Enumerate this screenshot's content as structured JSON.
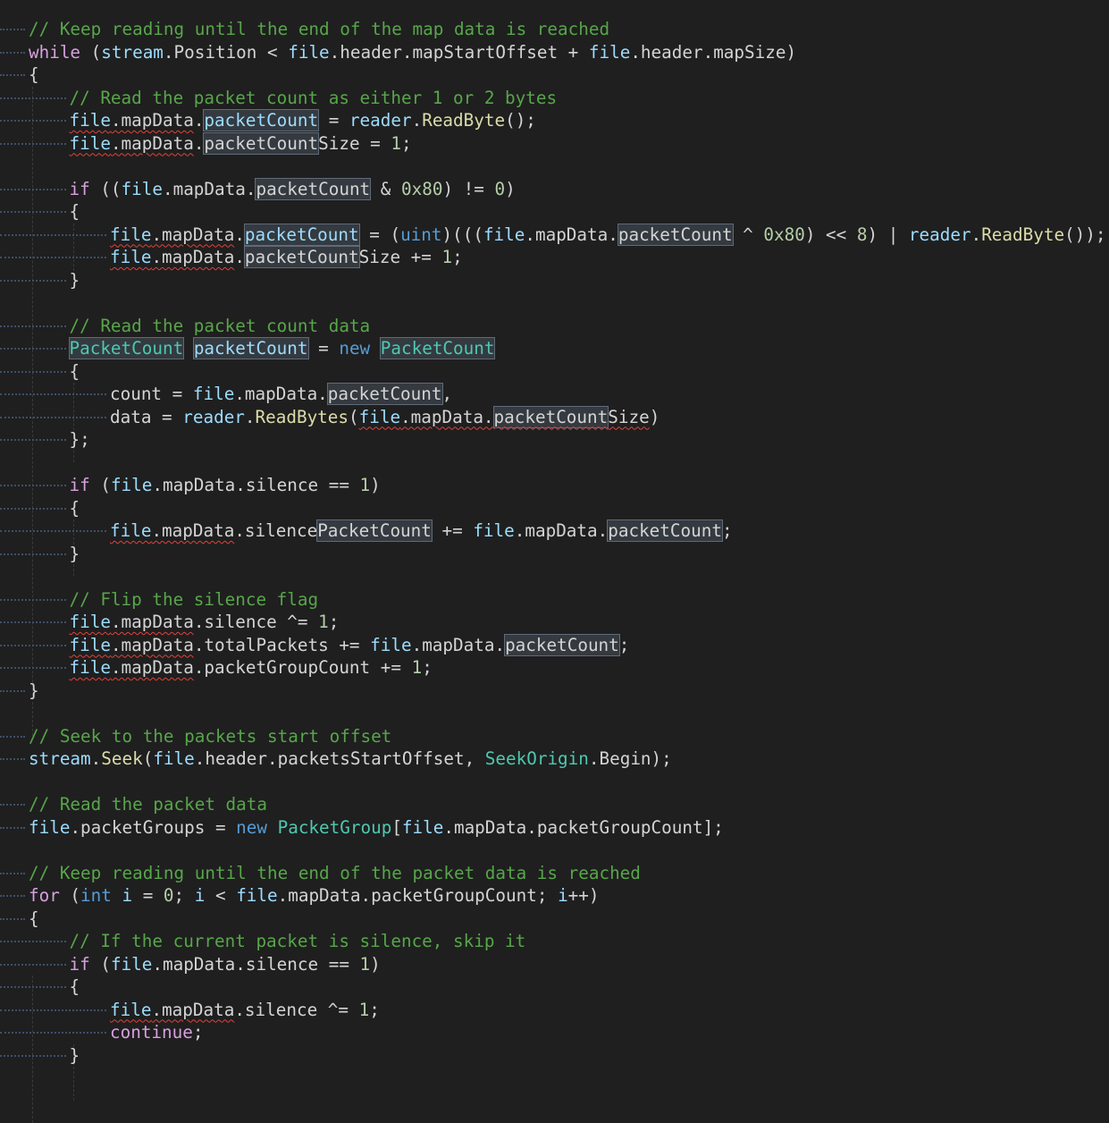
{
  "editor": {
    "lines": [
      {
        "i": 0,
        "t": [
          {
            "s": "// Keep reading until the end of the map data is reached",
            "c": "comment"
          }
        ]
      },
      {
        "i": 0,
        "t": [
          {
            "s": "while",
            "c": "kw-flow"
          },
          {
            "s": " (",
            "c": "punc"
          },
          {
            "s": "stream",
            "c": "var"
          },
          {
            "s": ".Position < ",
            "c": "punc"
          },
          {
            "s": "file",
            "c": "var"
          },
          {
            "s": ".header.mapStartOffset + ",
            "c": "punc"
          },
          {
            "s": "file",
            "c": "var"
          },
          {
            "s": ".header.mapSize)",
            "c": "punc"
          }
        ]
      },
      {
        "i": 0,
        "t": [
          {
            "s": "{",
            "c": "punc"
          }
        ]
      },
      {
        "i": 1,
        "t": [
          {
            "s": "// Read the packet count as either 1 or 2 bytes",
            "c": "comment"
          }
        ]
      },
      {
        "i": 1,
        "t": [
          {
            "s": "file",
            "c": "var sq"
          },
          {
            "s": ".mapData",
            "c": "punc sq"
          },
          {
            "s": ".",
            "c": "punc"
          },
          {
            "s": "packetCount",
            "c": "var hl"
          },
          {
            "s": " = ",
            "c": "punc"
          },
          {
            "s": "reader",
            "c": "var"
          },
          {
            "s": ".",
            "c": "punc"
          },
          {
            "s": "ReadByte",
            "c": "method"
          },
          {
            "s": "();",
            "c": "punc"
          }
        ]
      },
      {
        "i": 1,
        "t": [
          {
            "s": "file",
            "c": "var sq"
          },
          {
            "s": ".mapData",
            "c": "punc sq"
          },
          {
            "s": ".",
            "c": "punc"
          },
          {
            "s": "packetCount",
            "c": "punc hl"
          },
          {
            "s": "Size = ",
            "c": "punc"
          },
          {
            "s": "1",
            "c": "num"
          },
          {
            "s": ";",
            "c": "punc"
          }
        ]
      },
      {
        "i": 0,
        "t": []
      },
      {
        "i": 1,
        "t": [
          {
            "s": "if",
            "c": "kw-flow"
          },
          {
            "s": " ((",
            "c": "punc"
          },
          {
            "s": "file",
            "c": "var"
          },
          {
            "s": ".mapData.",
            "c": "punc"
          },
          {
            "s": "packetCount",
            "c": "punc hl"
          },
          {
            "s": " & ",
            "c": "punc"
          },
          {
            "s": "0x80",
            "c": "num"
          },
          {
            "s": ") != ",
            "c": "punc"
          },
          {
            "s": "0",
            "c": "num"
          },
          {
            "s": ")",
            "c": "punc"
          }
        ]
      },
      {
        "i": 1,
        "t": [
          {
            "s": "{",
            "c": "punc"
          }
        ]
      },
      {
        "i": 2,
        "t": [
          {
            "s": "file",
            "c": "var sq"
          },
          {
            "s": ".mapData",
            "c": "punc sq"
          },
          {
            "s": ".",
            "c": "punc"
          },
          {
            "s": "packetCount",
            "c": "var hl"
          },
          {
            "s": " = (",
            "c": "punc"
          },
          {
            "s": "uint",
            "c": "kw"
          },
          {
            "s": ")(((",
            "c": "punc"
          },
          {
            "s": "file",
            "c": "var"
          },
          {
            "s": ".mapData.",
            "c": "punc"
          },
          {
            "s": "packetCount",
            "c": "punc hl"
          },
          {
            "s": " ^ ",
            "c": "punc"
          },
          {
            "s": "0x80",
            "c": "num"
          },
          {
            "s": ") << ",
            "c": "punc"
          },
          {
            "s": "8",
            "c": "num"
          },
          {
            "s": ") | ",
            "c": "punc"
          },
          {
            "s": "reader",
            "c": "var"
          },
          {
            "s": ".",
            "c": "punc"
          },
          {
            "s": "ReadByte",
            "c": "method"
          },
          {
            "s": "());",
            "c": "punc"
          }
        ]
      },
      {
        "i": 2,
        "t": [
          {
            "s": "file",
            "c": "var sq"
          },
          {
            "s": ".mapData",
            "c": "punc sq"
          },
          {
            "s": ".",
            "c": "punc"
          },
          {
            "s": "packetCount",
            "c": "punc hl"
          },
          {
            "s": "Size += ",
            "c": "punc"
          },
          {
            "s": "1",
            "c": "num"
          },
          {
            "s": ";",
            "c": "punc"
          }
        ]
      },
      {
        "i": 1,
        "t": [
          {
            "s": "}",
            "c": "punc"
          }
        ]
      },
      {
        "i": 0,
        "t": []
      },
      {
        "i": 1,
        "t": [
          {
            "s": "// Read the packet count data",
            "c": "comment"
          }
        ]
      },
      {
        "i": 1,
        "t": [
          {
            "s": "PacketCount",
            "c": "type hl"
          },
          {
            "s": " ",
            "c": "punc"
          },
          {
            "s": "packetCount",
            "c": "var hl"
          },
          {
            "s": " = ",
            "c": "punc"
          },
          {
            "s": "new",
            "c": "kw"
          },
          {
            "s": " ",
            "c": "punc"
          },
          {
            "s": "PacketCount",
            "c": "type hl"
          }
        ]
      },
      {
        "i": 1,
        "t": [
          {
            "s": "{",
            "c": "punc"
          }
        ]
      },
      {
        "i": 2,
        "t": [
          {
            "s": "count = ",
            "c": "punc"
          },
          {
            "s": "file",
            "c": "var"
          },
          {
            "s": ".mapData.",
            "c": "punc"
          },
          {
            "s": "packetCount",
            "c": "punc hl"
          },
          {
            "s": ",",
            "c": "punc"
          }
        ]
      },
      {
        "i": 2,
        "t": [
          {
            "s": "data = ",
            "c": "punc"
          },
          {
            "s": "reader",
            "c": "var"
          },
          {
            "s": ".",
            "c": "punc"
          },
          {
            "s": "ReadBytes",
            "c": "method"
          },
          {
            "s": "(",
            "c": "punc"
          },
          {
            "s": "file",
            "c": "var sq"
          },
          {
            "s": ".mapData.",
            "c": "punc sq"
          },
          {
            "s": "packetCount",
            "c": "punc hl sq"
          },
          {
            "s": "Size",
            "c": "punc sq"
          },
          {
            "s": ")",
            "c": "punc"
          }
        ]
      },
      {
        "i": 1,
        "t": [
          {
            "s": "};",
            "c": "punc"
          }
        ]
      },
      {
        "i": 0,
        "t": []
      },
      {
        "i": 1,
        "t": [
          {
            "s": "if",
            "c": "kw-flow"
          },
          {
            "s": " (",
            "c": "punc"
          },
          {
            "s": "file",
            "c": "var"
          },
          {
            "s": ".mapData.silence == ",
            "c": "punc"
          },
          {
            "s": "1",
            "c": "num"
          },
          {
            "s": ")",
            "c": "punc"
          }
        ]
      },
      {
        "i": 1,
        "t": [
          {
            "s": "{",
            "c": "punc"
          }
        ]
      },
      {
        "i": 2,
        "t": [
          {
            "s": "file",
            "c": "var sq"
          },
          {
            "s": ".mapData",
            "c": "punc sq"
          },
          {
            "s": ".silence",
            "c": "punc"
          },
          {
            "s": "PacketCount",
            "c": "punc hl"
          },
          {
            "s": " += ",
            "c": "punc"
          },
          {
            "s": "file",
            "c": "var"
          },
          {
            "s": ".mapData.",
            "c": "punc"
          },
          {
            "s": "packetCount",
            "c": "punc hl"
          },
          {
            "s": ";",
            "c": "punc"
          }
        ]
      },
      {
        "i": 1,
        "t": [
          {
            "s": "}",
            "c": "punc"
          }
        ]
      },
      {
        "i": 0,
        "t": []
      },
      {
        "i": 1,
        "t": [
          {
            "s": "// Flip the silence flag",
            "c": "comment"
          }
        ]
      },
      {
        "i": 1,
        "t": [
          {
            "s": "file",
            "c": "var sq"
          },
          {
            "s": ".mapData",
            "c": "punc sq"
          },
          {
            "s": ".silence ^= ",
            "c": "punc"
          },
          {
            "s": "1",
            "c": "num"
          },
          {
            "s": ";",
            "c": "punc"
          }
        ]
      },
      {
        "i": 1,
        "t": [
          {
            "s": "file",
            "c": "var sq"
          },
          {
            "s": ".mapData",
            "c": "punc sq"
          },
          {
            "s": ".totalPackets += ",
            "c": "punc"
          },
          {
            "s": "file",
            "c": "var"
          },
          {
            "s": ".mapData.",
            "c": "punc"
          },
          {
            "s": "packetCount",
            "c": "punc hl"
          },
          {
            "s": ";",
            "c": "punc"
          }
        ]
      },
      {
        "i": 1,
        "t": [
          {
            "s": "file",
            "c": "var sq"
          },
          {
            "s": ".mapData",
            "c": "punc sq"
          },
          {
            "s": ".packetGroupCount += ",
            "c": "punc"
          },
          {
            "s": "1",
            "c": "num"
          },
          {
            "s": ";",
            "c": "punc"
          }
        ]
      },
      {
        "i": 0,
        "t": [
          {
            "s": "}",
            "c": "punc"
          }
        ]
      },
      {
        "i": 0,
        "t": []
      },
      {
        "i": 0,
        "t": [
          {
            "s": "// Seek to the packets start offset",
            "c": "comment"
          }
        ]
      },
      {
        "i": 0,
        "t": [
          {
            "s": "stream",
            "c": "var"
          },
          {
            "s": ".",
            "c": "punc"
          },
          {
            "s": "Seek",
            "c": "method"
          },
          {
            "s": "(",
            "c": "punc"
          },
          {
            "s": "file",
            "c": "var"
          },
          {
            "s": ".header.packetsStartOffset, ",
            "c": "punc"
          },
          {
            "s": "SeekOrigin",
            "c": "type"
          },
          {
            "s": ".Begin);",
            "c": "punc"
          }
        ]
      },
      {
        "i": 0,
        "t": []
      },
      {
        "i": 0,
        "t": [
          {
            "s": "// Read the packet data",
            "c": "comment"
          }
        ]
      },
      {
        "i": 0,
        "t": [
          {
            "s": "file",
            "c": "var"
          },
          {
            "s": ".packetGroups = ",
            "c": "punc"
          },
          {
            "s": "new",
            "c": "kw"
          },
          {
            "s": " ",
            "c": "punc"
          },
          {
            "s": "PacketGroup",
            "c": "type"
          },
          {
            "s": "[",
            "c": "punc"
          },
          {
            "s": "file",
            "c": "var"
          },
          {
            "s": ".mapData.packetGroupCount];",
            "c": "punc"
          }
        ]
      },
      {
        "i": 0,
        "t": []
      },
      {
        "i": 0,
        "t": [
          {
            "s": "// Keep reading until the end of the packet data is reached",
            "c": "comment"
          }
        ]
      },
      {
        "i": 0,
        "t": [
          {
            "s": "for",
            "c": "kw-flow"
          },
          {
            "s": " (",
            "c": "punc"
          },
          {
            "s": "int",
            "c": "kw"
          },
          {
            "s": " ",
            "c": "punc"
          },
          {
            "s": "i",
            "c": "var"
          },
          {
            "s": " = ",
            "c": "punc"
          },
          {
            "s": "0",
            "c": "num"
          },
          {
            "s": "; ",
            "c": "punc"
          },
          {
            "s": "i",
            "c": "var"
          },
          {
            "s": " < ",
            "c": "punc"
          },
          {
            "s": "file",
            "c": "var"
          },
          {
            "s": ".mapData.packetGroupCount; ",
            "c": "punc"
          },
          {
            "s": "i",
            "c": "var"
          },
          {
            "s": "++)",
            "c": "punc"
          }
        ]
      },
      {
        "i": 0,
        "t": [
          {
            "s": "{",
            "c": "punc"
          }
        ]
      },
      {
        "i": 1,
        "t": [
          {
            "s": "// If the current packet is silence, skip it",
            "c": "comment"
          }
        ]
      },
      {
        "i": 1,
        "t": [
          {
            "s": "if",
            "c": "kw-flow"
          },
          {
            "s": " (",
            "c": "punc"
          },
          {
            "s": "file",
            "c": "var"
          },
          {
            "s": ".mapData.silence == ",
            "c": "punc"
          },
          {
            "s": "1",
            "c": "num"
          },
          {
            "s": ")",
            "c": "punc"
          }
        ]
      },
      {
        "i": 1,
        "t": [
          {
            "s": "{",
            "c": "punc"
          }
        ]
      },
      {
        "i": 2,
        "t": [
          {
            "s": "file",
            "c": "var sq"
          },
          {
            "s": ".mapData",
            "c": "punc sq"
          },
          {
            "s": ".silence ^= ",
            "c": "punc"
          },
          {
            "s": "1",
            "c": "num"
          },
          {
            "s": ";",
            "c": "punc"
          }
        ]
      },
      {
        "i": 2,
        "t": [
          {
            "s": "continue",
            "c": "kw-flow"
          },
          {
            "s": ";",
            "c": "punc"
          }
        ]
      },
      {
        "i": 1,
        "t": [
          {
            "s": "}",
            "c": "punc"
          }
        ]
      },
      {
        "i": 0,
        "t": []
      }
    ]
  }
}
